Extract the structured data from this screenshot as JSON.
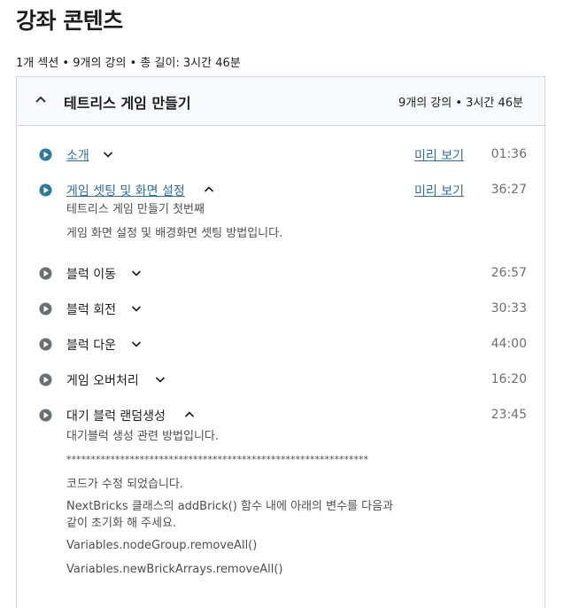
{
  "page_title": "강좌 콘텐츠",
  "summary": "1개 섹션 • 9개의 강의 • 총 길이: 3시간 46분",
  "section": {
    "title": "테트리스 게임 만들기",
    "meta": "9개의 강의 • 3시간 46분",
    "lectures": [
      {
        "title": "소개",
        "preview": "미리 보기",
        "duration": "01:36",
        "expanded": false
      },
      {
        "title": "게임 셋팅 및 화면 설정",
        "preview": "미리 보기",
        "duration": "36:27",
        "expanded": true,
        "description": [
          "테트리스 게임 만들기 첫번째",
          "게임 화면 설정 및 배경화면 셋팅 방법입니다."
        ]
      },
      {
        "title": "블럭 이동",
        "duration": "26:57",
        "expanded": false
      },
      {
        "title": "블럭 회전",
        "duration": "30:33",
        "expanded": false
      },
      {
        "title": "블럭 다운",
        "duration": "44:00",
        "expanded": false
      },
      {
        "title": "게임 오버처리",
        "duration": "16:20",
        "expanded": false
      },
      {
        "title": "대기 블럭 랜덤생성",
        "duration": "23:45",
        "expanded": true,
        "description": [
          "대기블럭 생성 관련 방법입니다.",
          "**************************************************************",
          "코드가 수정 되었습니다.",
          "NextBricks 클래스의 addBrick() 함수 내에 아래의 변수를 다음과",
          "같이 초기화 해 주세요.",
          "Variables.nodeGroup.removeAll()",
          "Variables.newBrickArrays.removeAll()"
        ]
      }
    ]
  },
  "colors": {
    "link": "#2d6ea3",
    "play_active": "#2d7b9c",
    "play_inactive": "#6a6f73"
  }
}
